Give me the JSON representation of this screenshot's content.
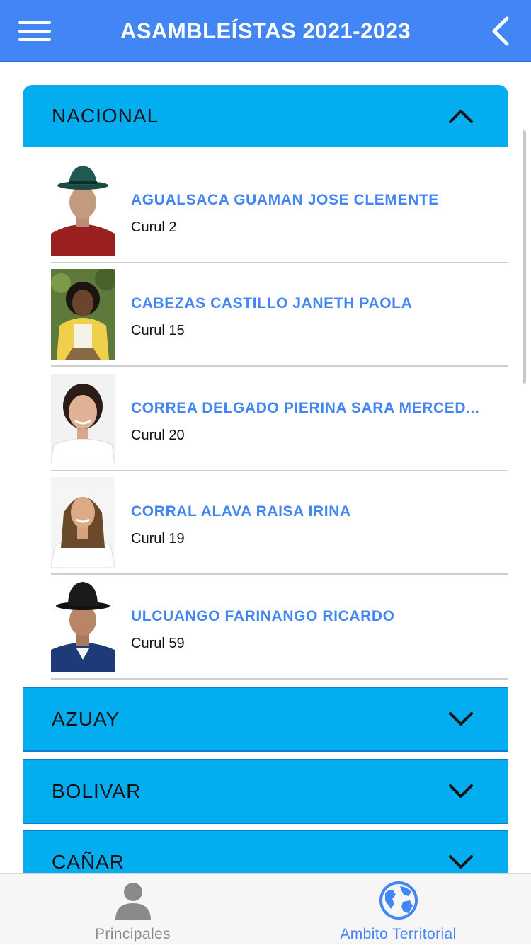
{
  "header": {
    "title": "ASAMBLEÍSTAS 2021-2023",
    "menu_icon": "hamburger-menu-icon",
    "back_icon": "chevron-left-icon"
  },
  "sections": {
    "nacional": {
      "title": "NACIONAL",
      "expanded": true
    },
    "azuay": {
      "title": "AZUAY",
      "expanded": false
    },
    "bolivar": {
      "title": "BOLIVAR",
      "expanded": false
    },
    "canar": {
      "title": "CAÑAR",
      "expanded": false
    }
  },
  "members": [
    {
      "name": "AGUALSACA GUAMAN JOSE CLEMENTE",
      "seat": "Curul 2"
    },
    {
      "name": "CABEZAS CASTILLO JANETH PAOLA",
      "seat": "Curul 15"
    },
    {
      "name": "CORREA DELGADO PIERINA SARA MERCED...",
      "seat": "Curul 20"
    },
    {
      "name": "CORRAL ALAVA RAISA IRINA",
      "seat": "Curul 19"
    },
    {
      "name": "ULCUANGO FARINANGO RICARDO",
      "seat": "Curul 59"
    }
  ],
  "bottom_nav": {
    "principales": {
      "label": "Principales",
      "icon": "person-icon",
      "active": false
    },
    "ambito": {
      "label": "Ambito Territorial",
      "icon": "globe-icon",
      "active": true
    }
  },
  "colors": {
    "app_bar": "#4285f4",
    "section_header": "#03aef0",
    "member_name": "#4285f4",
    "nav_active": "#4285f4",
    "nav_inactive": "#8a8a8a"
  }
}
